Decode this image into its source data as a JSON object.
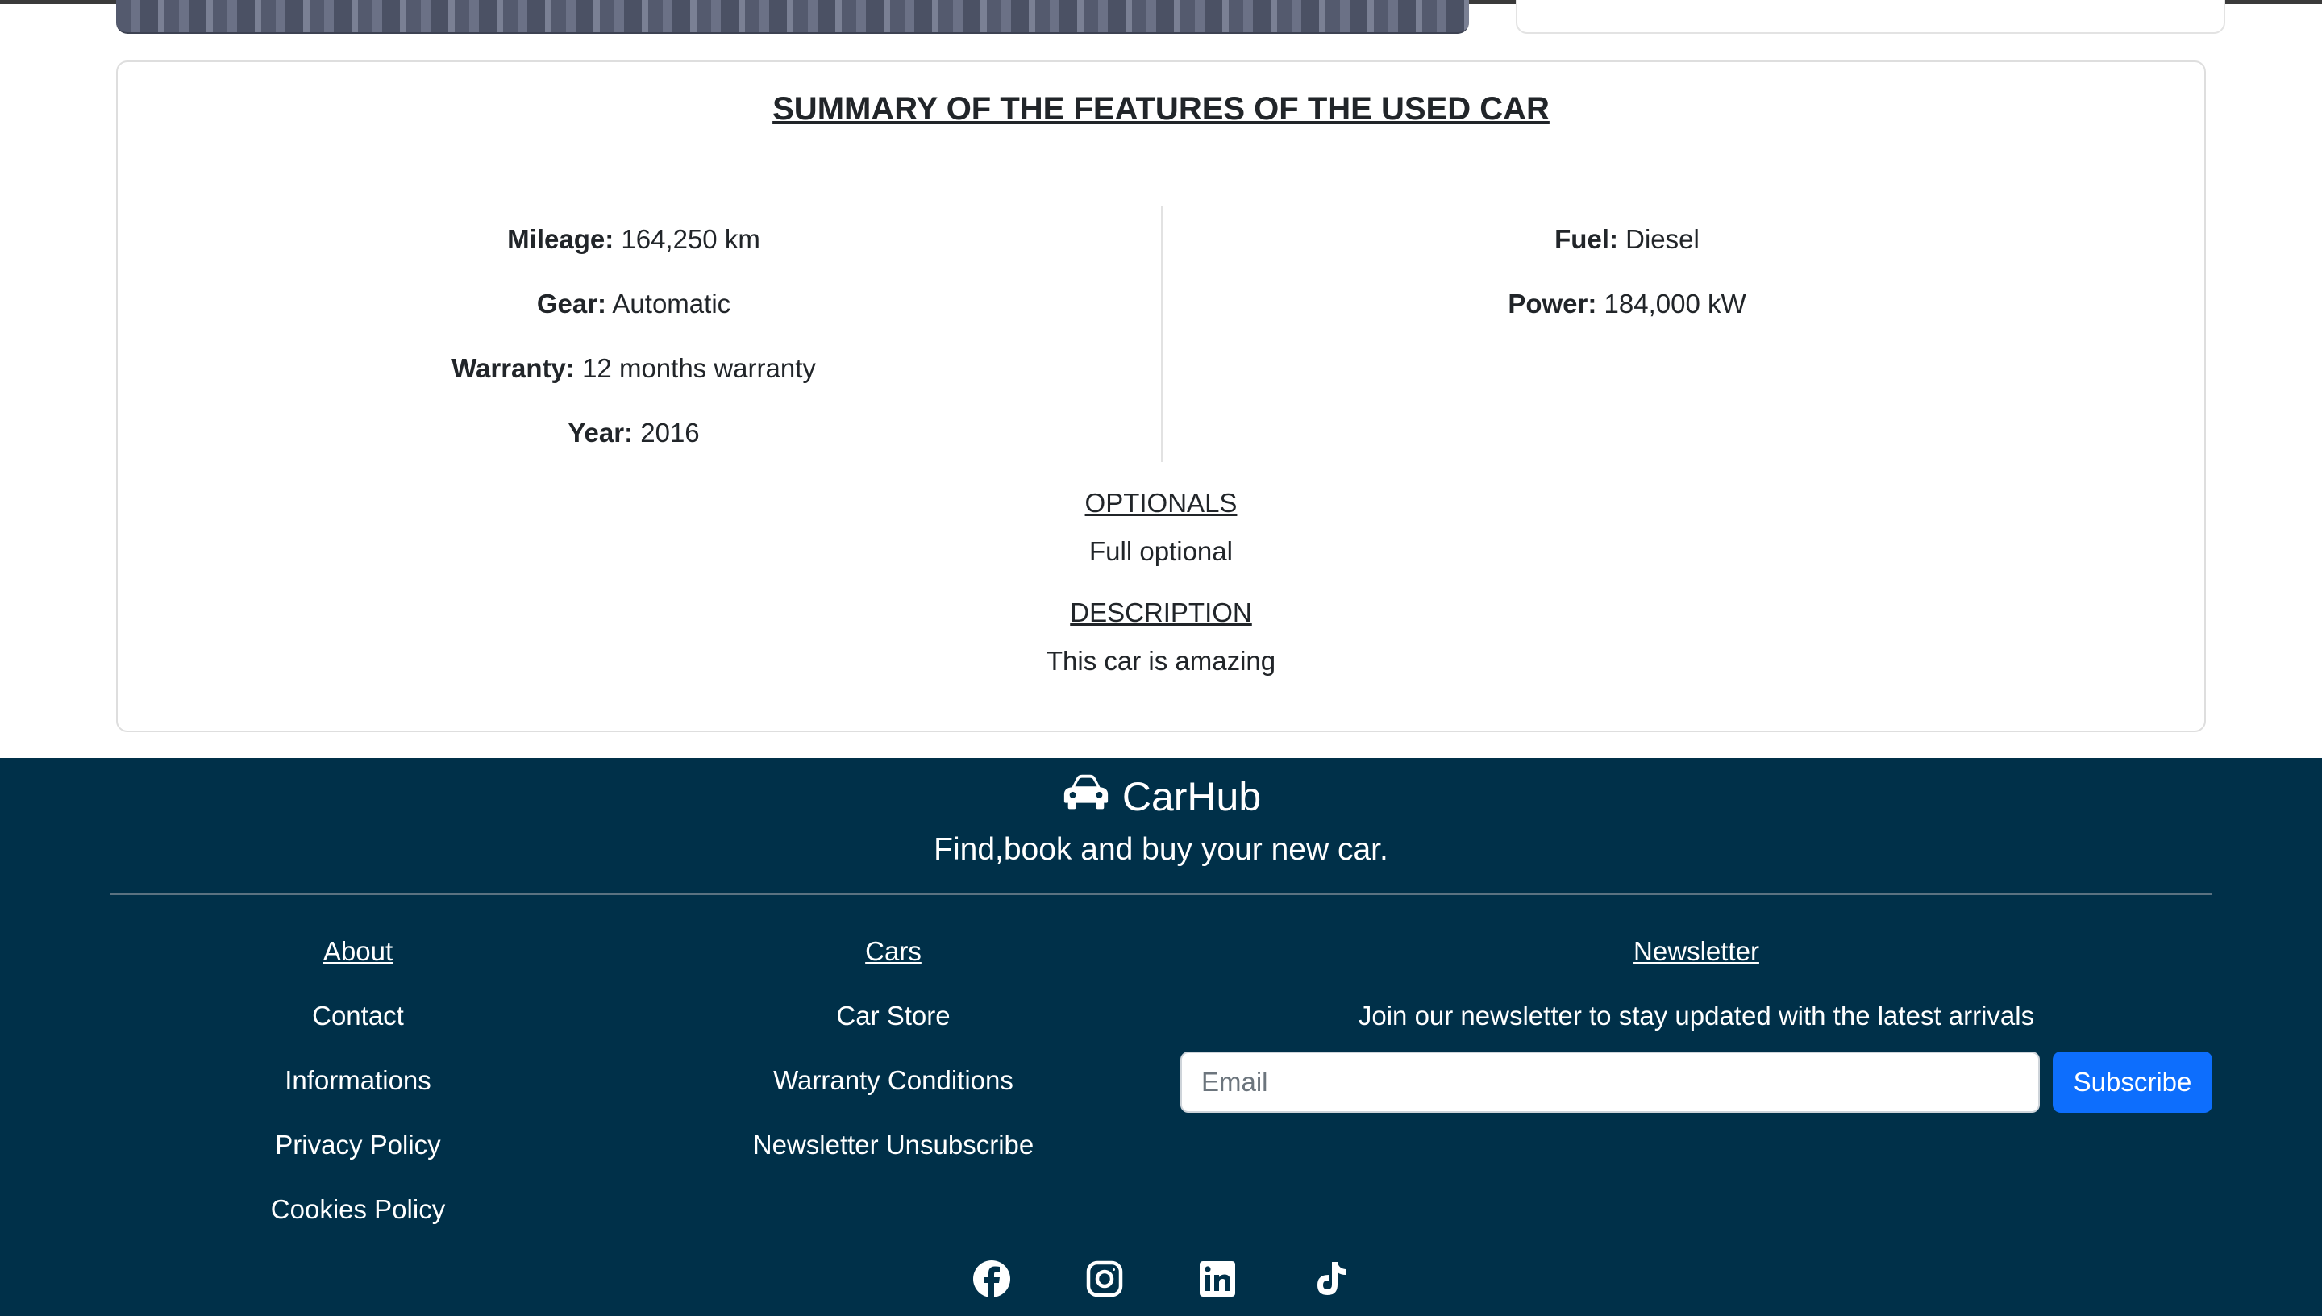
{
  "summary": {
    "title": "SUMMARY OF THE FEATURES OF THE USED CAR",
    "left_features": [
      {
        "label": "Mileage:",
        "value": "164,250 km"
      },
      {
        "label": "Gear:",
        "value": "Automatic"
      },
      {
        "label": "Warranty:",
        "value": "12 months warranty"
      },
      {
        "label": "Year:",
        "value": "2016"
      }
    ],
    "right_features": [
      {
        "label": "Fuel:",
        "value": "Diesel"
      },
      {
        "label": "Power:",
        "value": "184,000 kW"
      }
    ],
    "optionals_heading": "OPTIONALS",
    "optionals_text": "Full optional",
    "description_heading": "DESCRIPTION",
    "description_text": "This car is amazing"
  },
  "footer": {
    "brand": "CarHub",
    "brand_icon": "car-icon",
    "tagline": "Find,book and buy your new car.",
    "about_column": [
      "About",
      "Contact",
      "Informations",
      "Privacy Policy",
      "Cookies Policy"
    ],
    "cars_column": [
      "Cars",
      "Car Store",
      "Warranty Conditions",
      "Newsletter Unsubscribe"
    ],
    "newsletter": {
      "heading": "Newsletter",
      "text": "Join our newsletter to stay updated with the latest arrivals",
      "email_placeholder": "Email",
      "email_value": "",
      "subscribe_label": "Subscribe"
    },
    "social_icons": [
      "facebook-icon",
      "instagram-icon",
      "linkedin-icon",
      "tiktok-icon"
    ]
  },
  "colors": {
    "footer_background": "#003049",
    "subscribe_button": "#0d6efd",
    "text_dark": "#212529"
  }
}
